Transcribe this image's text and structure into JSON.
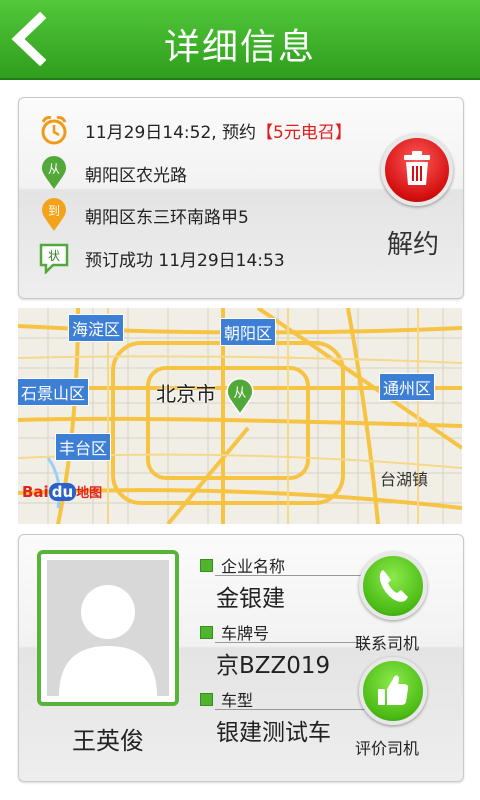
{
  "header": {
    "title": "详细信息",
    "back_icon": "back-arrow-icon"
  },
  "order": {
    "time_text": "11月29日14:52, 预约",
    "call_fee": "【5元电召】",
    "from_marker": "从",
    "from_address": "朝阳区农光路",
    "to_marker": "到",
    "to_address": "朝阳区东三环南路甲5",
    "status_marker": "状",
    "status_text": "预订成功 11月29日14:53",
    "cancel_label": "解约",
    "colors": {
      "alarm": "#f29a18",
      "from_pin": "#52a93a",
      "to_pin": "#f5a21b",
      "delete": "#d40f0f"
    }
  },
  "map": {
    "districts": [
      "海淀区",
      "朝阳区",
      "石景山区",
      "通州区",
      "丰台区"
    ],
    "towns": [
      "台湖镇"
    ],
    "city": "北京市",
    "marker": "从",
    "logo_bai": "Bai",
    "logo_du": "du",
    "logo_map": "地图"
  },
  "driver": {
    "name": "王英俊",
    "company_label": "企业名称",
    "company_value": "金银建",
    "plate_label": "车牌号",
    "plate_value": "京BZZ019",
    "model_label": "车型",
    "model_value": "银建测试车",
    "contact_label": "联系司机",
    "rate_label": "评价司机",
    "accent_color": "#4fb52f"
  }
}
